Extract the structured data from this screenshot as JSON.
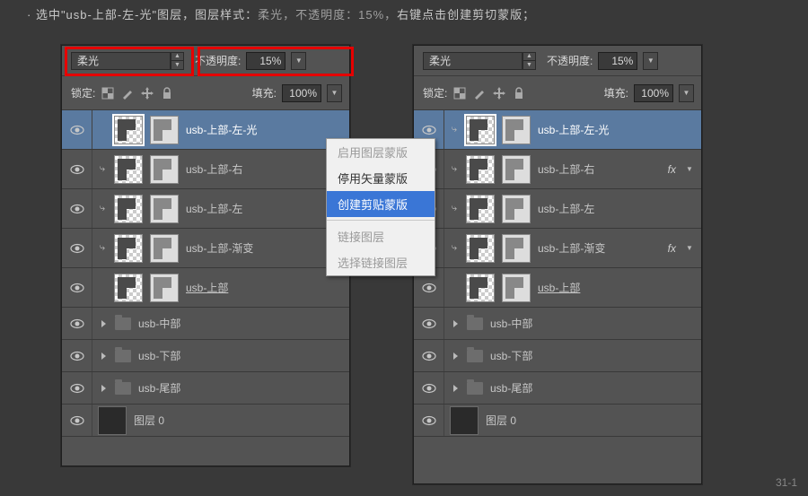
{
  "instruction": {
    "prefix": "· 选中\"usb-上部-左-光\"图层，图层样式：",
    "mid": "柔光，不透明度：15%，",
    "suffix": "右键点击创建剪切蒙版；"
  },
  "blendMode": "柔光",
  "opacityLabel": "不透明度:",
  "opacityValue": "15%",
  "lockLabel": "锁定:",
  "fillLabel": "填充:",
  "fillValue": "100%",
  "layersLeft": [
    {
      "name": "usb-上部-左-光",
      "kind": "thumb-sel",
      "clip": false,
      "sel": true
    },
    {
      "name": "usb-上部-右",
      "kind": "thumb",
      "clip": true
    },
    {
      "name": "usb-上部-左",
      "kind": "thumb",
      "clip": true
    },
    {
      "name": "usb-上部-渐变",
      "kind": "thumb",
      "clip": true
    },
    {
      "name": "usb-上部",
      "kind": "thumb-u",
      "clip": false
    },
    {
      "name": "usb-中部",
      "kind": "folder"
    },
    {
      "name": "usb-下部",
      "kind": "folder"
    },
    {
      "name": "usb-尾部",
      "kind": "folder"
    },
    {
      "name": "图层 0",
      "kind": "plain"
    }
  ],
  "layersRight": [
    {
      "name": "usb-上部-左-光",
      "kind": "thumb-sel",
      "clip": true,
      "sel": true
    },
    {
      "name": "usb-上部-右",
      "kind": "thumb",
      "clip": true,
      "fx": true
    },
    {
      "name": "usb-上部-左",
      "kind": "thumb",
      "clip": true
    },
    {
      "name": "usb-上部-渐变",
      "kind": "thumb",
      "clip": true,
      "fx": true
    },
    {
      "name": "usb-上部",
      "kind": "thumb-u",
      "clip": false
    },
    {
      "name": "usb-中部",
      "kind": "folder"
    },
    {
      "name": "usb-下部",
      "kind": "folder"
    },
    {
      "name": "usb-尾部",
      "kind": "folder"
    },
    {
      "name": "图层 0",
      "kind": "plain"
    }
  ],
  "contextMenu": [
    {
      "label": "启用图层蒙版",
      "state": "dis"
    },
    {
      "label": "停用矢量蒙版",
      "state": ""
    },
    {
      "label": "创建剪贴蒙版",
      "state": "hl"
    },
    {
      "label": "sep"
    },
    {
      "label": "链接图层",
      "state": "dis"
    },
    {
      "label": "选择链接图层",
      "state": "dis"
    }
  ],
  "fxLabel": "fx",
  "figureNum": "31-1"
}
